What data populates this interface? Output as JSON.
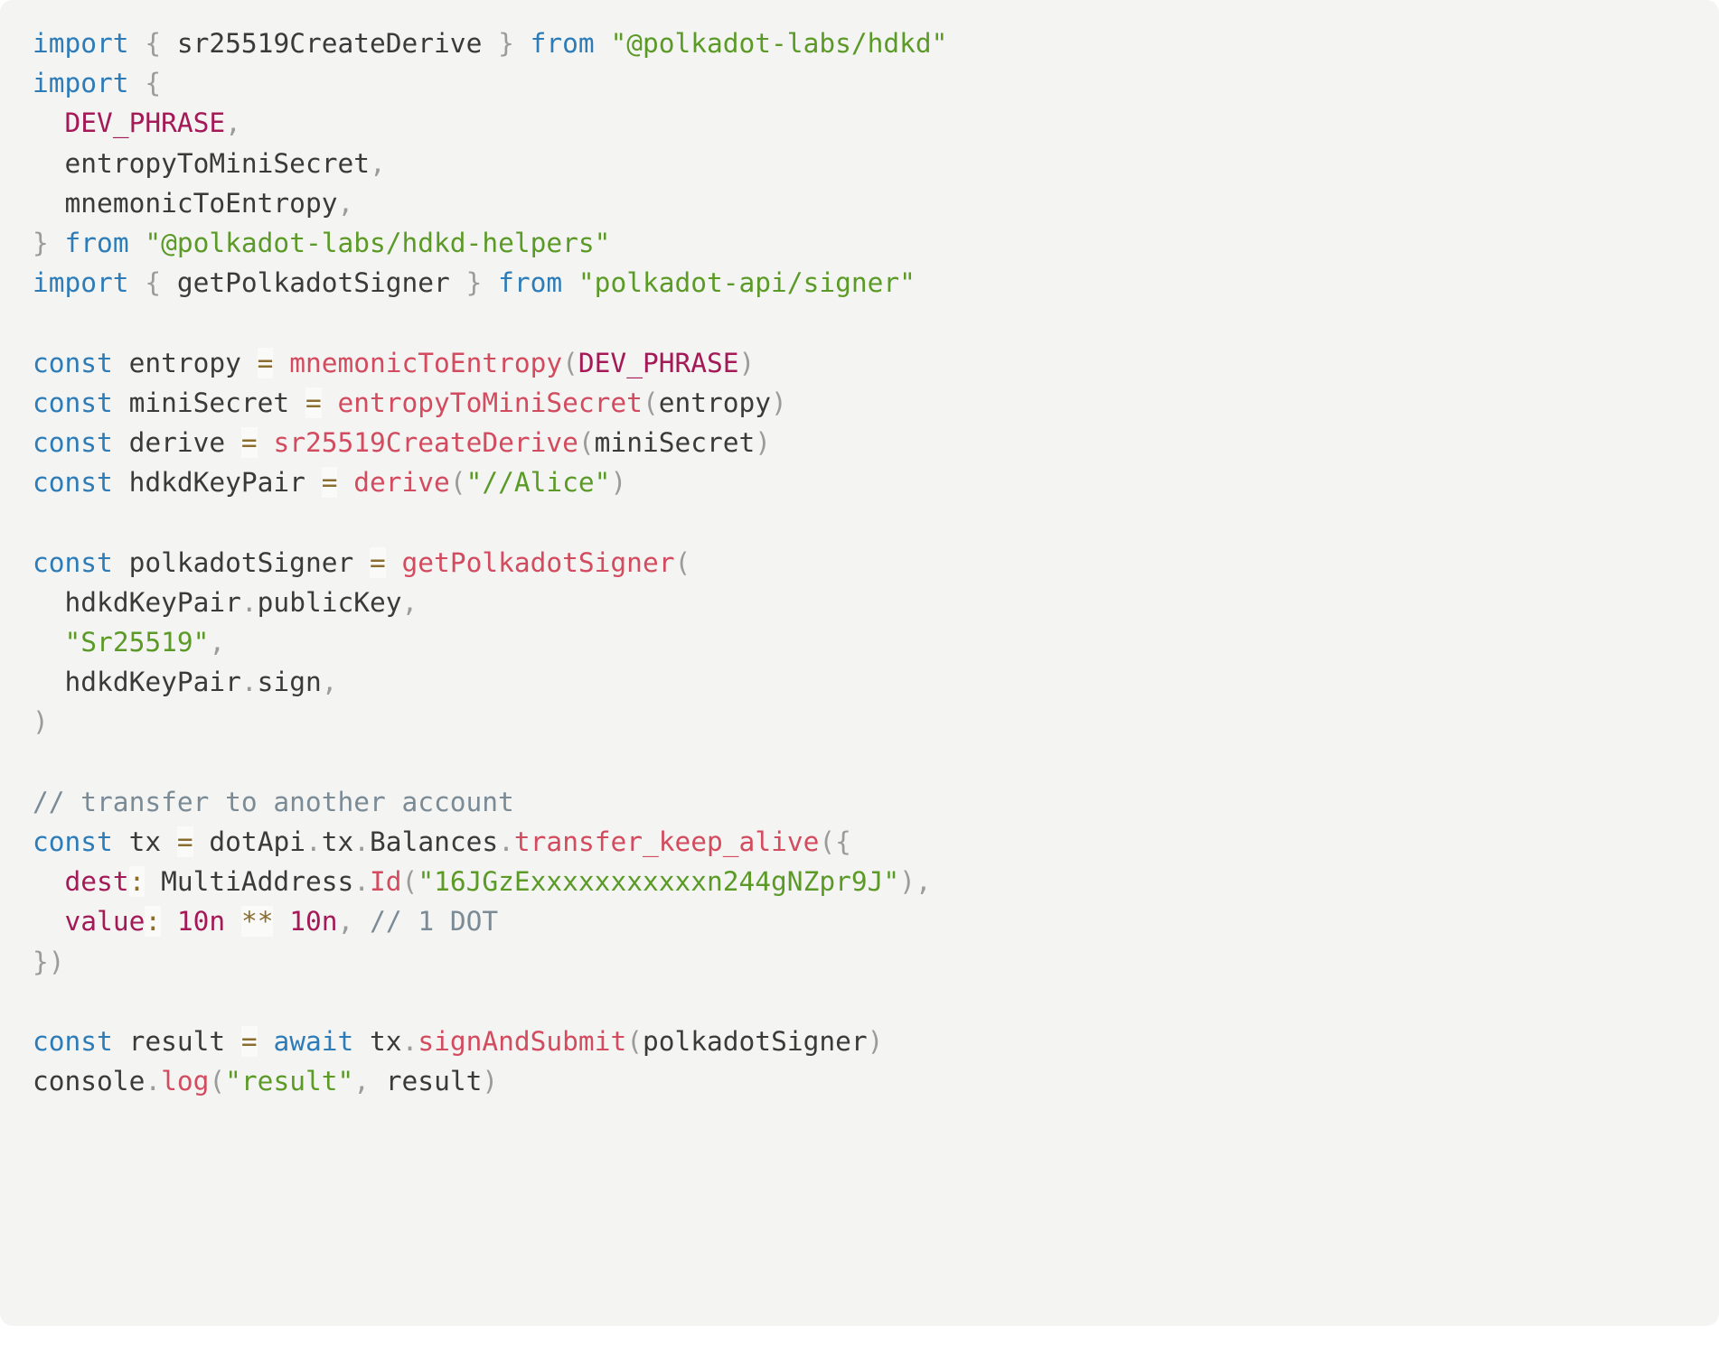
{
  "editor": {
    "language": "typescript",
    "background": "#f4f4f3",
    "page_background": "#ffffff",
    "theme": {
      "keyword": "#2d7cb8",
      "string": "#5c9a28",
      "function": "#d24b5e",
      "constant": "#a31a57",
      "identifier": "#3a3a3a",
      "punctuation": "#9b9b9b",
      "operator": "#8a6d2f",
      "comment": "#7b8b96"
    }
  },
  "code": {
    "plain_text": "import { sr25519CreateDerive } from \"@polkadot-labs/hdkd\"\nimport {\n  DEV_PHRASE,\n  entropyToMiniSecret,\n  mnemonicToEntropy,\n} from \"@polkadot-labs/hdkd-helpers\"\nimport { getPolkadotSigner } from \"polkadot-api/signer\"\n\nconst entropy = mnemonicToEntropy(DEV_PHRASE)\nconst miniSecret = entropyToMiniSecret(entropy)\nconst derive = sr25519CreateDerive(miniSecret)\nconst hdkdKeyPair = derive(\"//Alice\")\n\nconst polkadotSigner = getPolkadotSigner(\n  hdkdKeyPair.publicKey,\n  \"Sr25519\",\n  hdkdKeyPair.sign,\n)\n\n// transfer to another account\nconst tx = dotApi.tx.Balances.transfer_keep_alive({\n  dest: MultiAddress.Id(\"16JGzExxxxxxxxxxxn244gNZpr9J\"),\n  value: 10n ** 10n, // 1 DOT\n})\n\nconst result = await tx.signAndSubmit(polkadotSigner)\nconsole.log(\"result\", result)",
    "lines": [
      {
        "n": 1,
        "tokens": [
          {
            "t": "import",
            "c": "kw"
          },
          {
            "t": " ",
            "c": "id"
          },
          {
            "t": "{",
            "c": "pun"
          },
          {
            "t": " ",
            "c": "id"
          },
          {
            "t": "sr25519CreateDerive",
            "c": "id"
          },
          {
            "t": " ",
            "c": "id"
          },
          {
            "t": "}",
            "c": "pun"
          },
          {
            "t": " ",
            "c": "id"
          },
          {
            "t": "from",
            "c": "kw"
          },
          {
            "t": " ",
            "c": "id"
          },
          {
            "t": "\"@polkadot-labs/hdkd\"",
            "c": "str"
          }
        ]
      },
      {
        "n": 2,
        "tokens": [
          {
            "t": "import",
            "c": "kw"
          },
          {
            "t": " ",
            "c": "id"
          },
          {
            "t": "{",
            "c": "pun"
          }
        ]
      },
      {
        "n": 3,
        "tokens": [
          {
            "t": "  ",
            "c": "id"
          },
          {
            "t": "DEV_PHRASE",
            "c": "cst"
          },
          {
            "t": ",",
            "c": "pun"
          }
        ]
      },
      {
        "n": 4,
        "tokens": [
          {
            "t": "  ",
            "c": "id"
          },
          {
            "t": "entropyToMiniSecret",
            "c": "id"
          },
          {
            "t": ",",
            "c": "pun"
          }
        ]
      },
      {
        "n": 5,
        "tokens": [
          {
            "t": "  ",
            "c": "id"
          },
          {
            "t": "mnemonicToEntropy",
            "c": "id"
          },
          {
            "t": ",",
            "c": "pun"
          }
        ]
      },
      {
        "n": 6,
        "tokens": [
          {
            "t": "}",
            "c": "pun"
          },
          {
            "t": " ",
            "c": "id"
          },
          {
            "t": "from",
            "c": "kw"
          },
          {
            "t": " ",
            "c": "id"
          },
          {
            "t": "\"@polkadot-labs/hdkd-helpers\"",
            "c": "str"
          }
        ]
      },
      {
        "n": 7,
        "tokens": [
          {
            "t": "import",
            "c": "kw"
          },
          {
            "t": " ",
            "c": "id"
          },
          {
            "t": "{",
            "c": "pun"
          },
          {
            "t": " ",
            "c": "id"
          },
          {
            "t": "getPolkadotSigner",
            "c": "id"
          },
          {
            "t": " ",
            "c": "id"
          },
          {
            "t": "}",
            "c": "pun"
          },
          {
            "t": " ",
            "c": "id"
          },
          {
            "t": "from",
            "c": "kw"
          },
          {
            "t": " ",
            "c": "id"
          },
          {
            "t": "\"polkadot-api/signer\"",
            "c": "str"
          }
        ]
      },
      {
        "n": 8,
        "tokens": []
      },
      {
        "n": 9,
        "tokens": [
          {
            "t": "const",
            "c": "kw"
          },
          {
            "t": " ",
            "c": "id"
          },
          {
            "t": "entropy",
            "c": "id"
          },
          {
            "t": " ",
            "c": "id"
          },
          {
            "t": "=",
            "c": "op"
          },
          {
            "t": " ",
            "c": "id"
          },
          {
            "t": "mnemonicToEntropy",
            "c": "fn"
          },
          {
            "t": "(",
            "c": "pun"
          },
          {
            "t": "DEV_PHRASE",
            "c": "cst"
          },
          {
            "t": ")",
            "c": "pun"
          }
        ]
      },
      {
        "n": 10,
        "tokens": [
          {
            "t": "const",
            "c": "kw"
          },
          {
            "t": " ",
            "c": "id"
          },
          {
            "t": "miniSecret",
            "c": "id"
          },
          {
            "t": " ",
            "c": "id"
          },
          {
            "t": "=",
            "c": "op"
          },
          {
            "t": " ",
            "c": "id"
          },
          {
            "t": "entropyToMiniSecret",
            "c": "fn"
          },
          {
            "t": "(",
            "c": "pun"
          },
          {
            "t": "entropy",
            "c": "id"
          },
          {
            "t": ")",
            "c": "pun"
          }
        ]
      },
      {
        "n": 11,
        "tokens": [
          {
            "t": "const",
            "c": "kw"
          },
          {
            "t": " ",
            "c": "id"
          },
          {
            "t": "derive",
            "c": "id"
          },
          {
            "t": " ",
            "c": "id"
          },
          {
            "t": "=",
            "c": "op"
          },
          {
            "t": " ",
            "c": "id"
          },
          {
            "t": "sr25519CreateDerive",
            "c": "fn"
          },
          {
            "t": "(",
            "c": "pun"
          },
          {
            "t": "miniSecret",
            "c": "id"
          },
          {
            "t": ")",
            "c": "pun"
          }
        ]
      },
      {
        "n": 12,
        "tokens": [
          {
            "t": "const",
            "c": "kw"
          },
          {
            "t": " ",
            "c": "id"
          },
          {
            "t": "hdkdKeyPair",
            "c": "id"
          },
          {
            "t": " ",
            "c": "id"
          },
          {
            "t": "=",
            "c": "op"
          },
          {
            "t": " ",
            "c": "id"
          },
          {
            "t": "derive",
            "c": "fn"
          },
          {
            "t": "(",
            "c": "pun"
          },
          {
            "t": "\"//Alice\"",
            "c": "str"
          },
          {
            "t": ")",
            "c": "pun"
          }
        ]
      },
      {
        "n": 13,
        "tokens": []
      },
      {
        "n": 14,
        "tokens": [
          {
            "t": "const",
            "c": "kw"
          },
          {
            "t": " ",
            "c": "id"
          },
          {
            "t": "polkadotSigner",
            "c": "id"
          },
          {
            "t": " ",
            "c": "id"
          },
          {
            "t": "=",
            "c": "op"
          },
          {
            "t": " ",
            "c": "id"
          },
          {
            "t": "getPolkadotSigner",
            "c": "fn"
          },
          {
            "t": "(",
            "c": "pun"
          }
        ]
      },
      {
        "n": 15,
        "tokens": [
          {
            "t": "  ",
            "c": "id"
          },
          {
            "t": "hdkdKeyPair",
            "c": "id"
          },
          {
            "t": ".",
            "c": "pun"
          },
          {
            "t": "publicKey",
            "c": "id"
          },
          {
            "t": ",",
            "c": "pun"
          }
        ]
      },
      {
        "n": 16,
        "tokens": [
          {
            "t": "  ",
            "c": "id"
          },
          {
            "t": "\"Sr25519\"",
            "c": "str"
          },
          {
            "t": ",",
            "c": "pun"
          }
        ]
      },
      {
        "n": 17,
        "tokens": [
          {
            "t": "  ",
            "c": "id"
          },
          {
            "t": "hdkdKeyPair",
            "c": "id"
          },
          {
            "t": ".",
            "c": "pun"
          },
          {
            "t": "sign",
            "c": "id"
          },
          {
            "t": ",",
            "c": "pun"
          }
        ]
      },
      {
        "n": 18,
        "tokens": [
          {
            "t": ")",
            "c": "pun"
          }
        ]
      },
      {
        "n": 19,
        "tokens": []
      },
      {
        "n": 20,
        "tokens": [
          {
            "t": "// transfer to another account",
            "c": "cmt"
          }
        ]
      },
      {
        "n": 21,
        "tokens": [
          {
            "t": "const",
            "c": "kw"
          },
          {
            "t": " ",
            "c": "id"
          },
          {
            "t": "tx",
            "c": "id"
          },
          {
            "t": " ",
            "c": "id"
          },
          {
            "t": "=",
            "c": "op"
          },
          {
            "t": " ",
            "c": "id"
          },
          {
            "t": "dotApi",
            "c": "id"
          },
          {
            "t": ".",
            "c": "pun"
          },
          {
            "t": "tx",
            "c": "id"
          },
          {
            "t": ".",
            "c": "pun"
          },
          {
            "t": "Balances",
            "c": "id"
          },
          {
            "t": ".",
            "c": "pun"
          },
          {
            "t": "transfer_keep_alive",
            "c": "fn"
          },
          {
            "t": "(",
            "c": "pun"
          },
          {
            "t": "{",
            "c": "pun"
          }
        ]
      },
      {
        "n": 22,
        "tokens": [
          {
            "t": "  ",
            "c": "id"
          },
          {
            "t": "dest",
            "c": "cst"
          },
          {
            "t": ":",
            "c": "op"
          },
          {
            "t": " ",
            "c": "id"
          },
          {
            "t": "MultiAddress",
            "c": "id"
          },
          {
            "t": ".",
            "c": "pun"
          },
          {
            "t": "Id",
            "c": "fn"
          },
          {
            "t": "(",
            "c": "pun"
          },
          {
            "t": "\"16JGzExxxxxxxxxxxn244gNZpr9J\"",
            "c": "str"
          },
          {
            "t": ")",
            "c": "pun"
          },
          {
            "t": ",",
            "c": "pun"
          }
        ]
      },
      {
        "n": 23,
        "tokens": [
          {
            "t": "  ",
            "c": "id"
          },
          {
            "t": "value",
            "c": "cst"
          },
          {
            "t": ":",
            "c": "op"
          },
          {
            "t": " ",
            "c": "id"
          },
          {
            "t": "10n",
            "c": "cst"
          },
          {
            "t": " ",
            "c": "id"
          },
          {
            "t": "**",
            "c": "op"
          },
          {
            "t": " ",
            "c": "id"
          },
          {
            "t": "10n",
            "c": "cst"
          },
          {
            "t": ",",
            "c": "pun"
          },
          {
            "t": " ",
            "c": "id"
          },
          {
            "t": "// 1 DOT",
            "c": "cmt"
          }
        ]
      },
      {
        "n": 24,
        "tokens": [
          {
            "t": "}",
            "c": "pun"
          },
          {
            "t": ")",
            "c": "pun"
          }
        ]
      },
      {
        "n": 25,
        "tokens": []
      },
      {
        "n": 26,
        "tokens": [
          {
            "t": "const",
            "c": "kw"
          },
          {
            "t": " ",
            "c": "id"
          },
          {
            "t": "result",
            "c": "id"
          },
          {
            "t": " ",
            "c": "id"
          },
          {
            "t": "=",
            "c": "op"
          },
          {
            "t": " ",
            "c": "id"
          },
          {
            "t": "await",
            "c": "kw"
          },
          {
            "t": " ",
            "c": "id"
          },
          {
            "t": "tx",
            "c": "id"
          },
          {
            "t": ".",
            "c": "pun"
          },
          {
            "t": "signAndSubmit",
            "c": "fn"
          },
          {
            "t": "(",
            "c": "pun"
          },
          {
            "t": "polkadotSigner",
            "c": "id"
          },
          {
            "t": ")",
            "c": "pun"
          }
        ]
      },
      {
        "n": 27,
        "tokens": [
          {
            "t": "console",
            "c": "id"
          },
          {
            "t": ".",
            "c": "pun"
          },
          {
            "t": "log",
            "c": "fn"
          },
          {
            "t": "(",
            "c": "pun"
          },
          {
            "t": "\"result\"",
            "c": "str"
          },
          {
            "t": ",",
            "c": "pun"
          },
          {
            "t": " ",
            "c": "id"
          },
          {
            "t": "result",
            "c": "id"
          },
          {
            "t": ")",
            "c": "pun"
          }
        ]
      }
    ]
  }
}
